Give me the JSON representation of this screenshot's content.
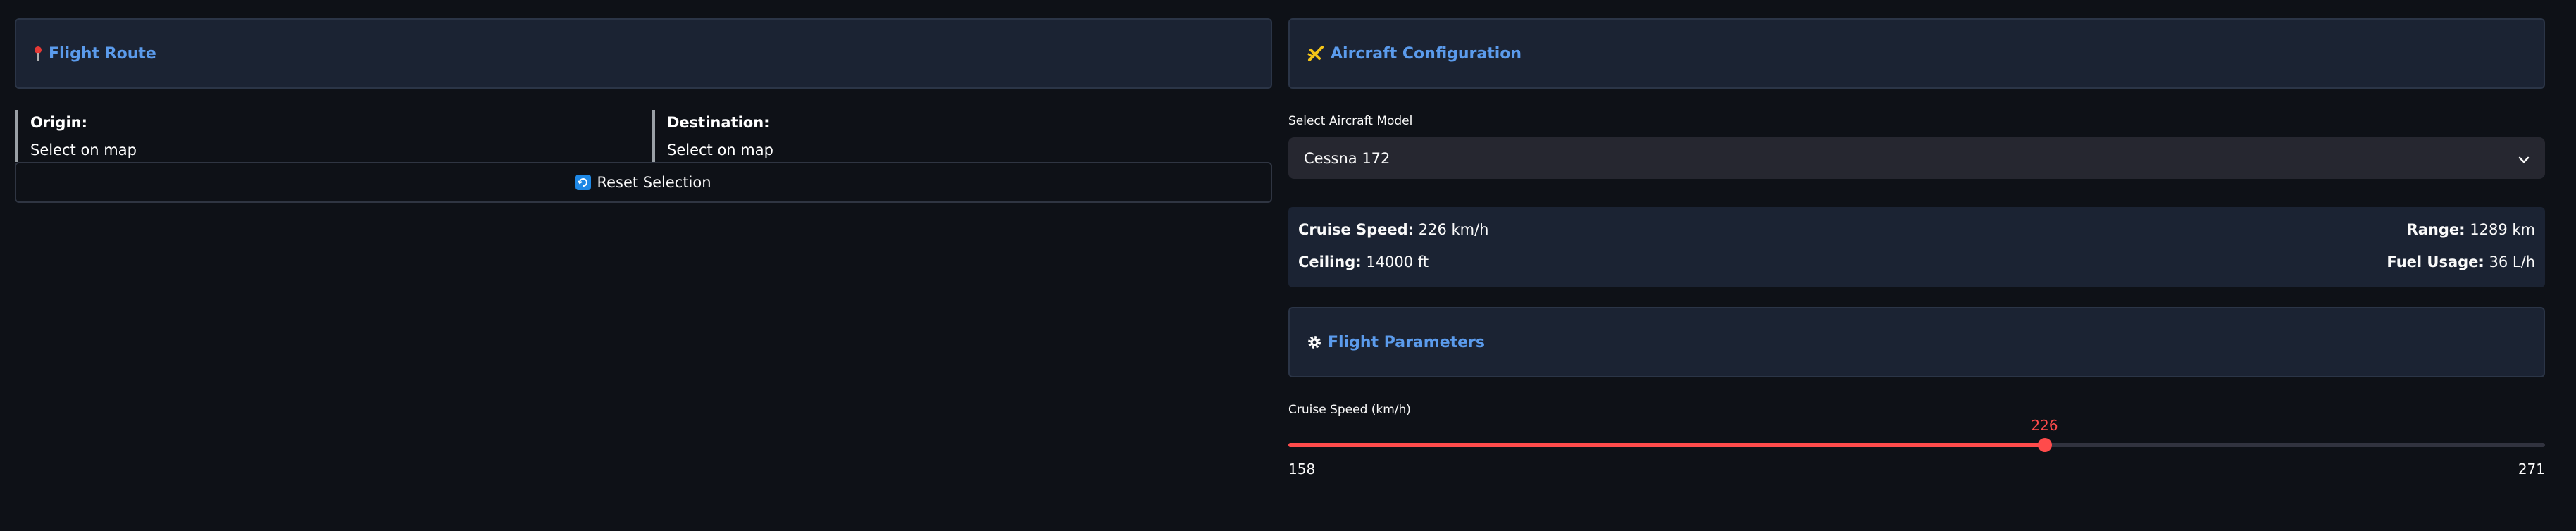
{
  "flight_route": {
    "title": "Flight Route",
    "icon": "pushpin-icon",
    "origin": {
      "label": "Origin:",
      "value": "Select on map"
    },
    "destination": {
      "label": "Destination:",
      "value": "Select on map"
    },
    "reset_button": {
      "label": "Reset Selection",
      "icon": "refresh-icon"
    }
  },
  "aircraft_config": {
    "title": "Aircraft Configuration",
    "icon": "airplane-icon",
    "select_label": "Select Aircraft Model",
    "selected_model": "Cessna 172",
    "stats": {
      "cruise_speed": {
        "label": "Cruise Speed:",
        "value": "226 km/h"
      },
      "range": {
        "label": "Range:",
        "value": "1289 km"
      },
      "ceiling": {
        "label": "Ceiling:",
        "value": "14000 ft"
      },
      "fuel_usage": {
        "label": "Fuel Usage:",
        "value": "36 L/h"
      }
    }
  },
  "flight_params": {
    "title": "Flight Parameters",
    "icon": "gear-icon",
    "cruise_speed_slider": {
      "label": "Cruise Speed (km/h)",
      "value": "226",
      "min": "158",
      "max": "271"
    }
  },
  "colors": {
    "background": "#0e1117",
    "card": "#1b2333",
    "accent_blue": "#5b9bec",
    "slider_red": "#ff4b4b"
  }
}
